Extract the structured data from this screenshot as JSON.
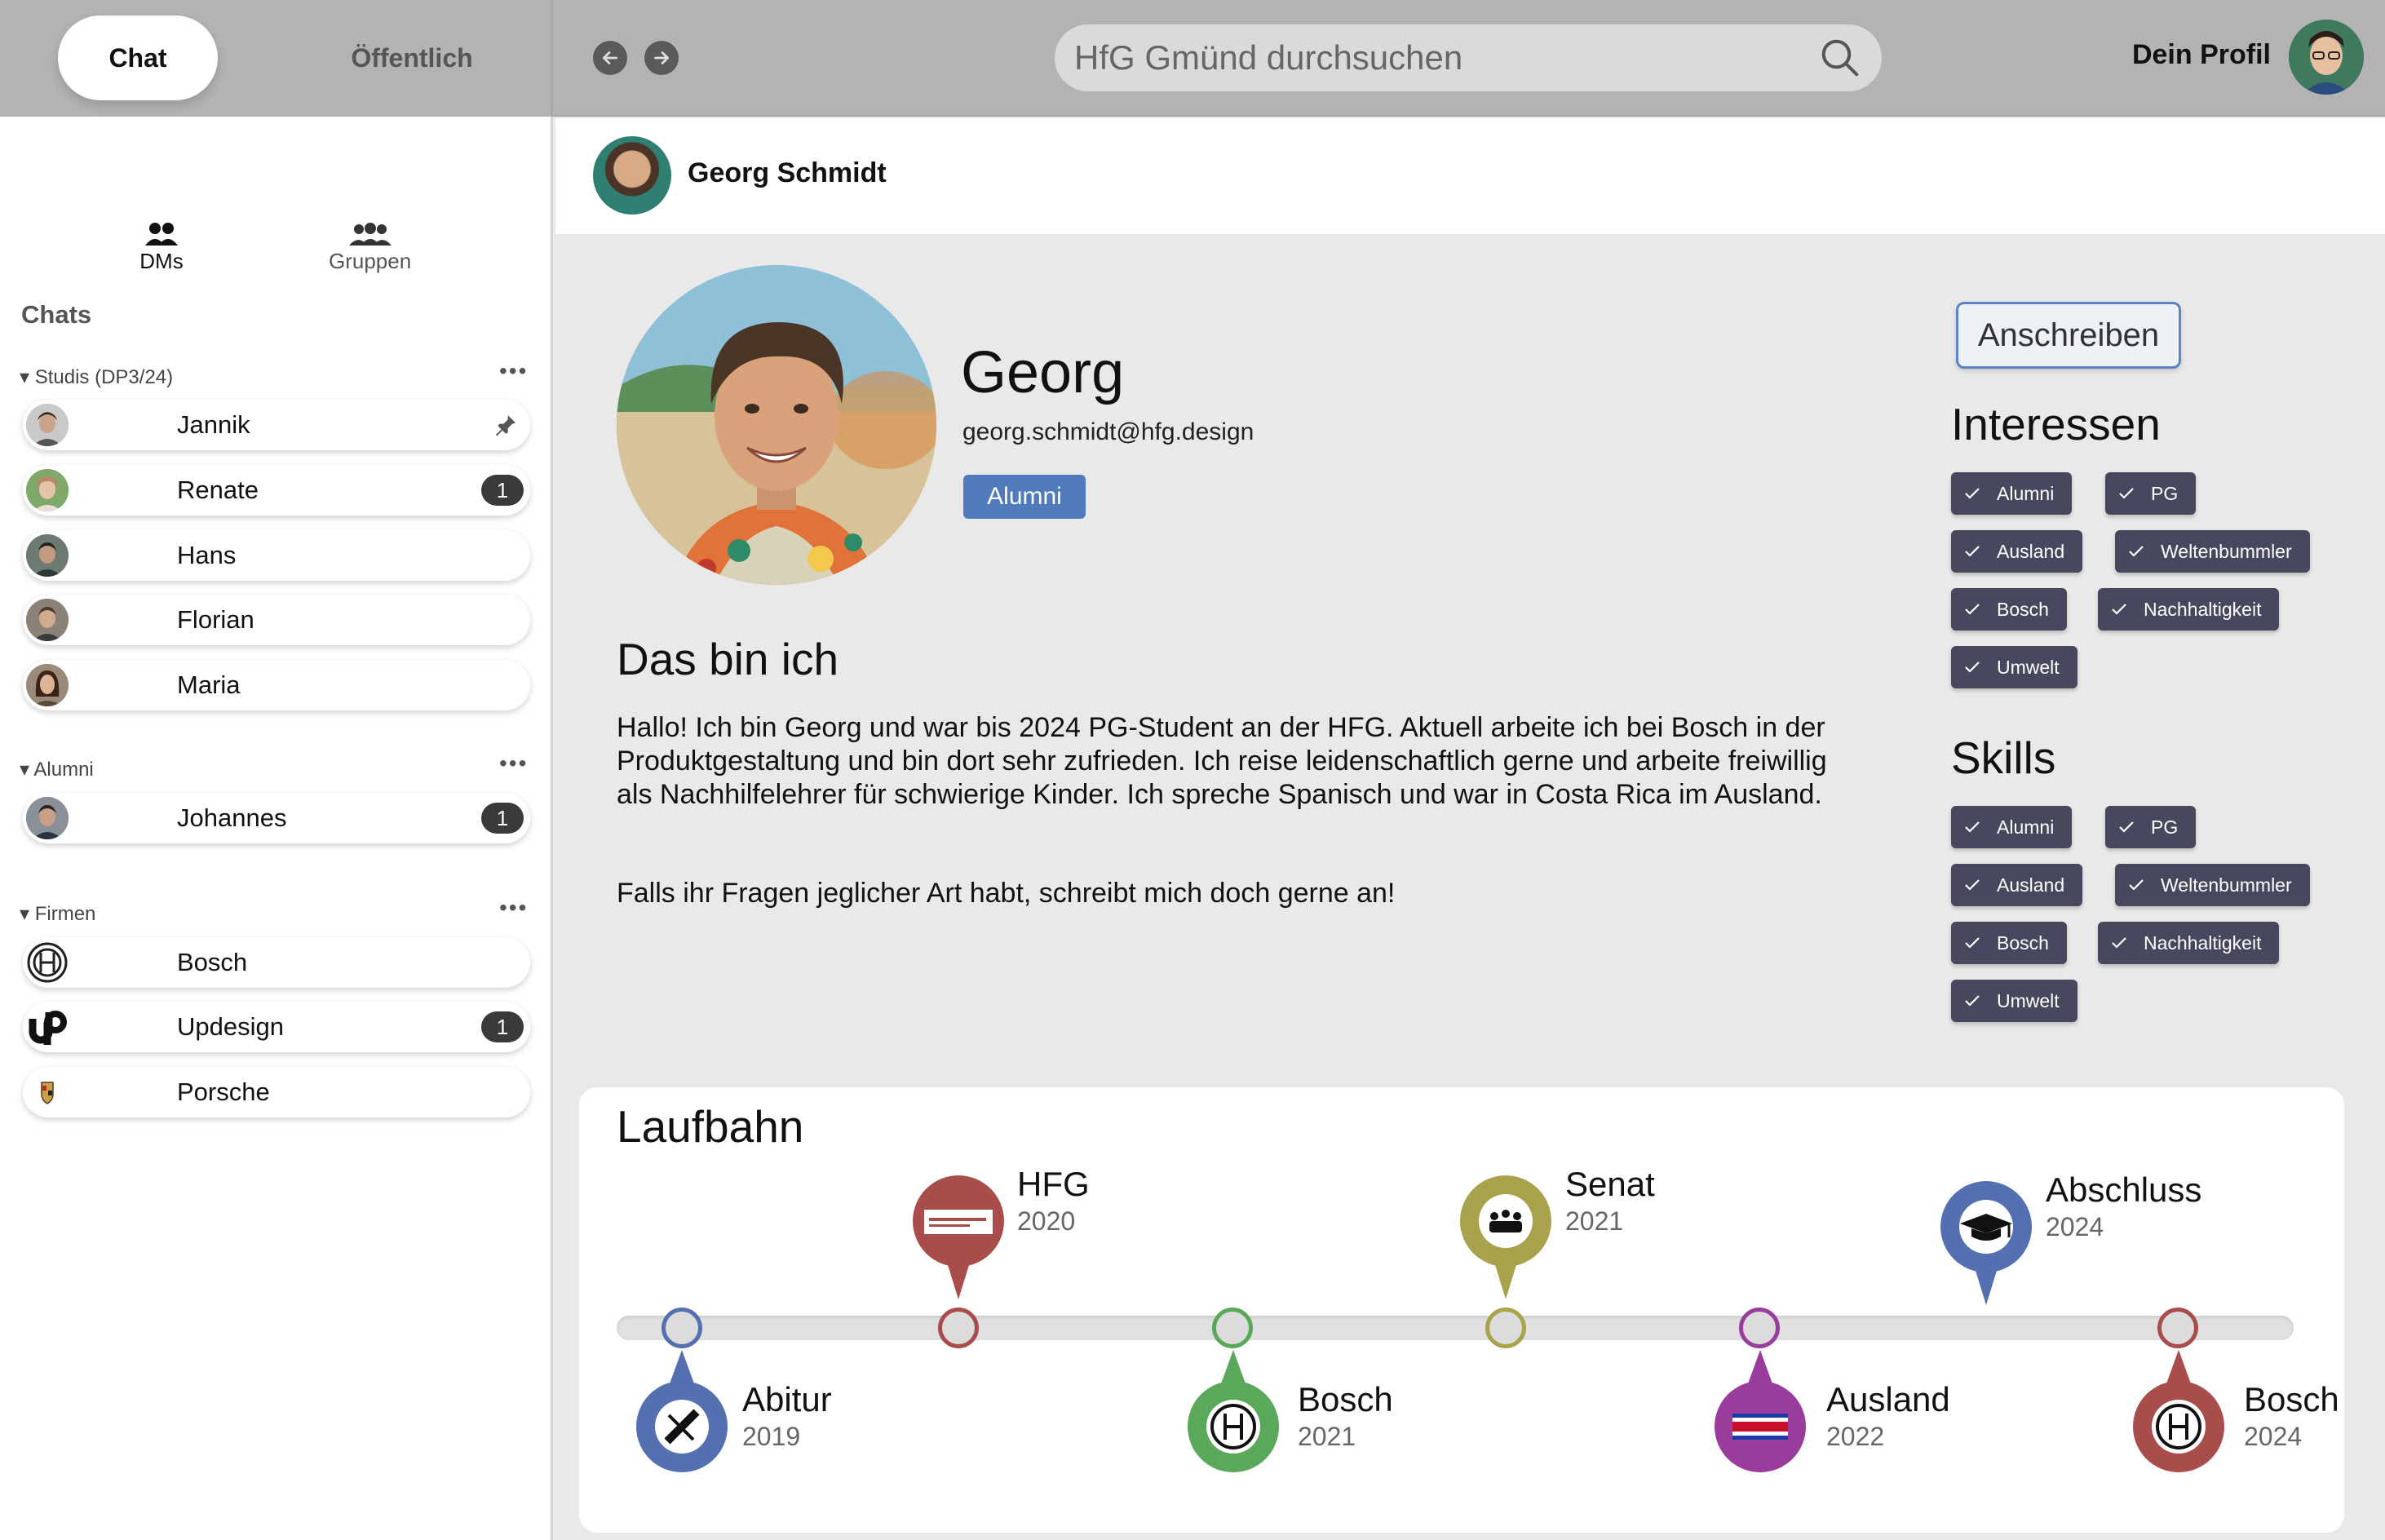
{
  "topbar": {
    "tab_chat": "Chat",
    "tab_public": "Öffentlich",
    "search_placeholder": "HfG Gmünd durchsuchen",
    "profile_label": "Dein Profil"
  },
  "sidebar": {
    "tab_dms": "DMs",
    "tab_groups": "Gruppen",
    "chats_title": "Chats",
    "groups": [
      {
        "title": "Studis (DP3/24)",
        "items": [
          {
            "name": "Jannik",
            "pinned": true
          },
          {
            "name": "Renate",
            "unread": "1"
          },
          {
            "name": "Hans"
          },
          {
            "name": "Florian"
          },
          {
            "name": "Maria"
          }
        ]
      },
      {
        "title": "Alumni",
        "items": [
          {
            "name": "Johannes",
            "unread": "1"
          }
        ]
      },
      {
        "title": "Firmen",
        "items": [
          {
            "name": "Bosch"
          },
          {
            "name": "Updesign",
            "unread": "1"
          },
          {
            "name": "Porsche"
          }
        ]
      }
    ]
  },
  "header": {
    "name": "Georg Schmidt"
  },
  "profile": {
    "first_name": "Georg",
    "email": "georg.schmidt@hfg.design",
    "badge": "Alumni",
    "about_title": "Das bin ich",
    "about_text": "Hallo! Ich bin Georg und war bis 2024 PG-Student an der HFG. Aktuell arbeite ich bei Bosch in der Produktgestaltung und bin dort sehr zufrieden. Ich reise leidenschaftlich gerne und arbeite freiwillig als Nachhilfelehrer für schwierige Kinder. Ich spreche Spanisch und war in Costa Rica im Ausland.",
    "about_text2": "Falls ihr Fragen jeglicher Art habt, schreibt mich doch gerne an!",
    "write_button": "Anschreiben",
    "interests_title": "Interessen",
    "interests": [
      "Alumni",
      "PG",
      "Ausland",
      "Weltenbummler",
      "Bosch",
      "Nachhaltigkeit",
      "Umwelt"
    ],
    "skills_title": "Skills",
    "skills": [
      "Alumni",
      "PG",
      "Ausland",
      "Weltenbummler",
      "Bosch",
      "Nachhaltigkeit",
      "Umwelt"
    ]
  },
  "career": {
    "title": "Laufbahn",
    "events": [
      {
        "label": "Abitur",
        "year": "2019",
        "color": "#5470b0",
        "icon": "diploma-icon"
      },
      {
        "label": "HFG",
        "year": "2020",
        "color": "#a84c4c",
        "icon": "hfg-logo-icon"
      },
      {
        "label": "Bosch",
        "year": "2021",
        "color": "#5aa85a",
        "icon": "bosch-icon"
      },
      {
        "label": "Senat",
        "year": "2021",
        "color": "#a8a24c",
        "icon": "senate-icon"
      },
      {
        "label": "Ausland",
        "year": "2022",
        "color": "#9a3c9c",
        "icon": "costa-rica-flag-icon"
      },
      {
        "label": "Abschluss",
        "year": "2024",
        "color": "#5470b0",
        "icon": "graduation-cap-icon"
      },
      {
        "label": "Bosch",
        "year": "2024",
        "color": "#a84c4c",
        "icon": "bosch-icon"
      }
    ]
  }
}
